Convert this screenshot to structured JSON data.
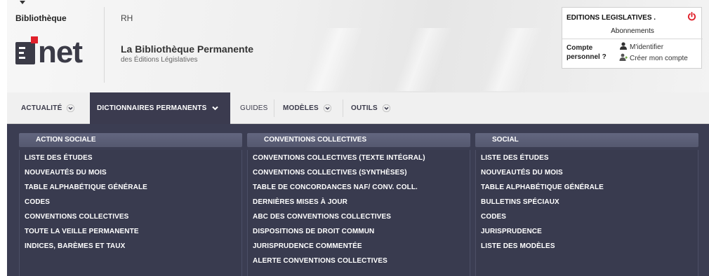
{
  "header": {
    "library_label": "Bibliothèque",
    "rh_link": "RH",
    "logo_text": "net",
    "brand_title": "La Bibliothèque Permanente",
    "brand_subtitle": "des Éditions Législatives"
  },
  "account": {
    "company": "EDITIONS LEGISLATIVES .",
    "subscriptions": "Abonnements",
    "compte_label_line1": "Compte",
    "compte_label_line2": "personnel ?",
    "login_link": "M'identifier",
    "create_link": "Créer mon compte"
  },
  "nav": {
    "items": [
      {
        "label": "ACTUALITÉ"
      },
      {
        "label": "DICTIONNAIRES PERMANENTS"
      },
      {
        "label": "GUIDES"
      },
      {
        "label": "MODÈLES"
      },
      {
        "label": "OUTILS"
      }
    ]
  },
  "dropdown": {
    "columns": [
      {
        "title": "ACTION SOCIALE",
        "items": [
          "LISTE DES ÉTUDES",
          "NOUVEAUTÉS DU MOIS",
          "TABLE ALPHABÉTIQUE GÉNÉRALE",
          "CODES",
          "CONVENTIONS COLLECTIVES",
          "TOUTE LA VEILLE PERMANENTE",
          "INDICES, BARÈMES ET TAUX"
        ]
      },
      {
        "title": "CONVENTIONS COLLECTIVES",
        "items": [
          "CONVENTIONS COLLECTIVES (TEXTE INTÉGRAL)",
          "CONVENTIONS COLLECTIVES (SYNTHÈSES)",
          "TABLE DE CONCORDANCES NAF/ CONV. COLL.",
          "DERNIÈRES MISES À JOUR",
          "ABC DES CONVENTIONS COLLECTIVES",
          "DISPOSITIONS DE DROIT COMMUN",
          "JURISPRUDENCE COMMENTÉE",
          "ALERTE CONVENTIONS COLLECTIVES"
        ]
      },
      {
        "title": "SOCIAL",
        "items": [
          "LISTE DES ÉTUDES",
          "NOUVEAUTÉS DU MOIS",
          "TABLE ALPHABÉTIQUE GÉNÉRALE",
          "BULLETINS SPÉCIAUX",
          "CODES",
          "JURISPRUDENCE",
          "LISTE DES MODÈLES"
        ]
      }
    ]
  },
  "colors": {
    "accent_red": "#e0202a",
    "nav_active_bg": "#3b3b4f",
    "panel_bg": "#3b3d52",
    "column_header_bg": "#5c6078"
  },
  "icons": {
    "power": "power-icon",
    "login": "user-icon",
    "create": "user-add-icon",
    "dropdown": "chevron-down-icon"
  }
}
